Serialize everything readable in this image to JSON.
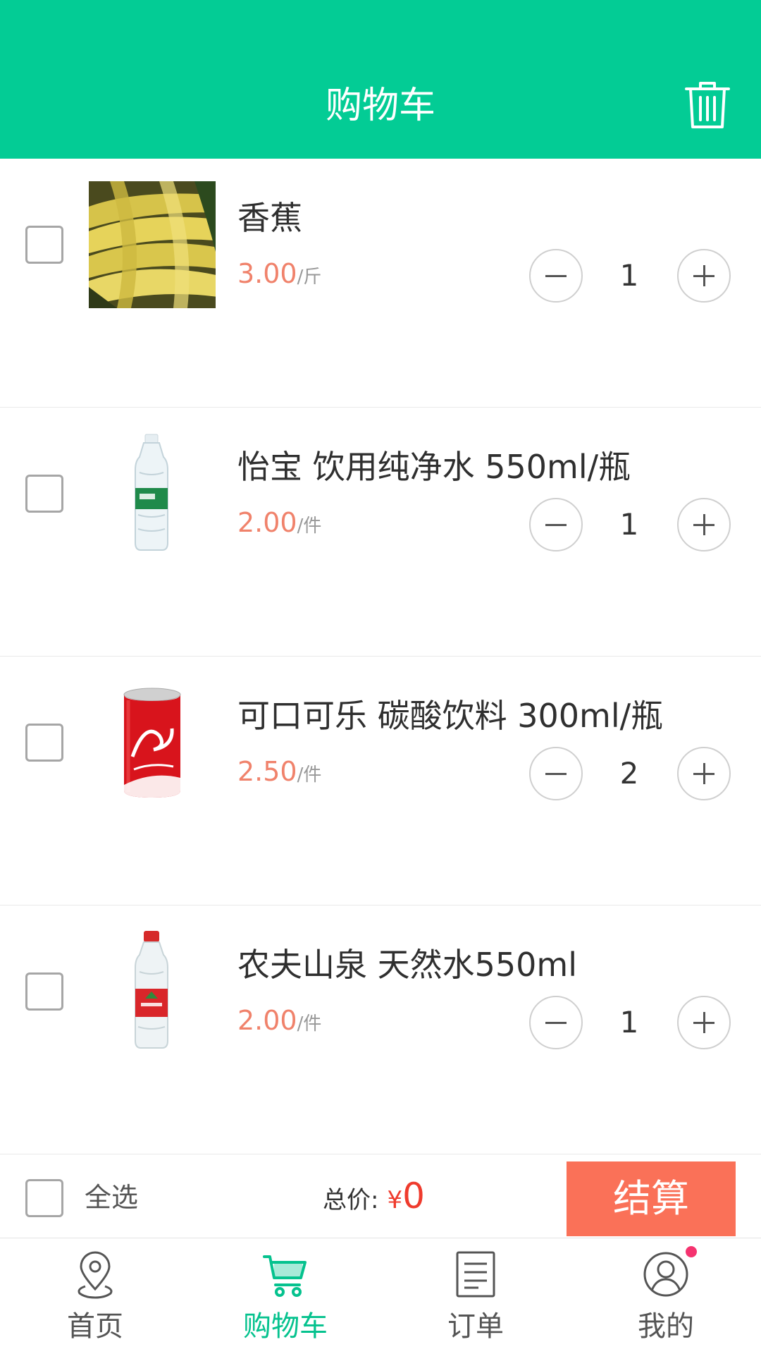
{
  "header": {
    "title": "购物车",
    "background": "#03cc95",
    "delete_icon": "trash-icon"
  },
  "items": [
    {
      "name": "香蕉",
      "price": "3.00",
      "unit": "/斤",
      "quantity": "1",
      "image": "banana-image",
      "checked": false
    },
    {
      "name": "怡宝 饮用纯净水 550ml/瓶",
      "price": "2.00",
      "unit": "/件",
      "quantity": "1",
      "image": "water-bottle-green-label",
      "checked": false
    },
    {
      "name": "可口可乐 碳酸饮料 300ml/瓶",
      "price": "2.50",
      "unit": "/件",
      "quantity": "2",
      "image": "coca-cola-can",
      "checked": false
    },
    {
      "name": "农夫山泉 天然水550ml",
      "price": "2.00",
      "unit": "/件",
      "quantity": "1",
      "image": "water-bottle-red-label",
      "checked": false
    }
  ],
  "footer": {
    "select_all": "全选",
    "total_label": "总价:",
    "currency": "¥",
    "total_value": "0",
    "checkout": "结算"
  },
  "tabs": [
    {
      "label": "首页",
      "icon": "location-pin-icon",
      "active": false
    },
    {
      "label": "购物车",
      "icon": "cart-icon",
      "active": true
    },
    {
      "label": "订单",
      "icon": "order-list-icon",
      "active": false
    },
    {
      "label": "我的",
      "icon": "user-icon",
      "active": false,
      "badge": true
    }
  ],
  "colors": {
    "accent": "#03cc95",
    "price": "#f0826b",
    "total": "#ef3b2d",
    "checkout_button": "#fa7158",
    "badge": "#f5336f"
  }
}
